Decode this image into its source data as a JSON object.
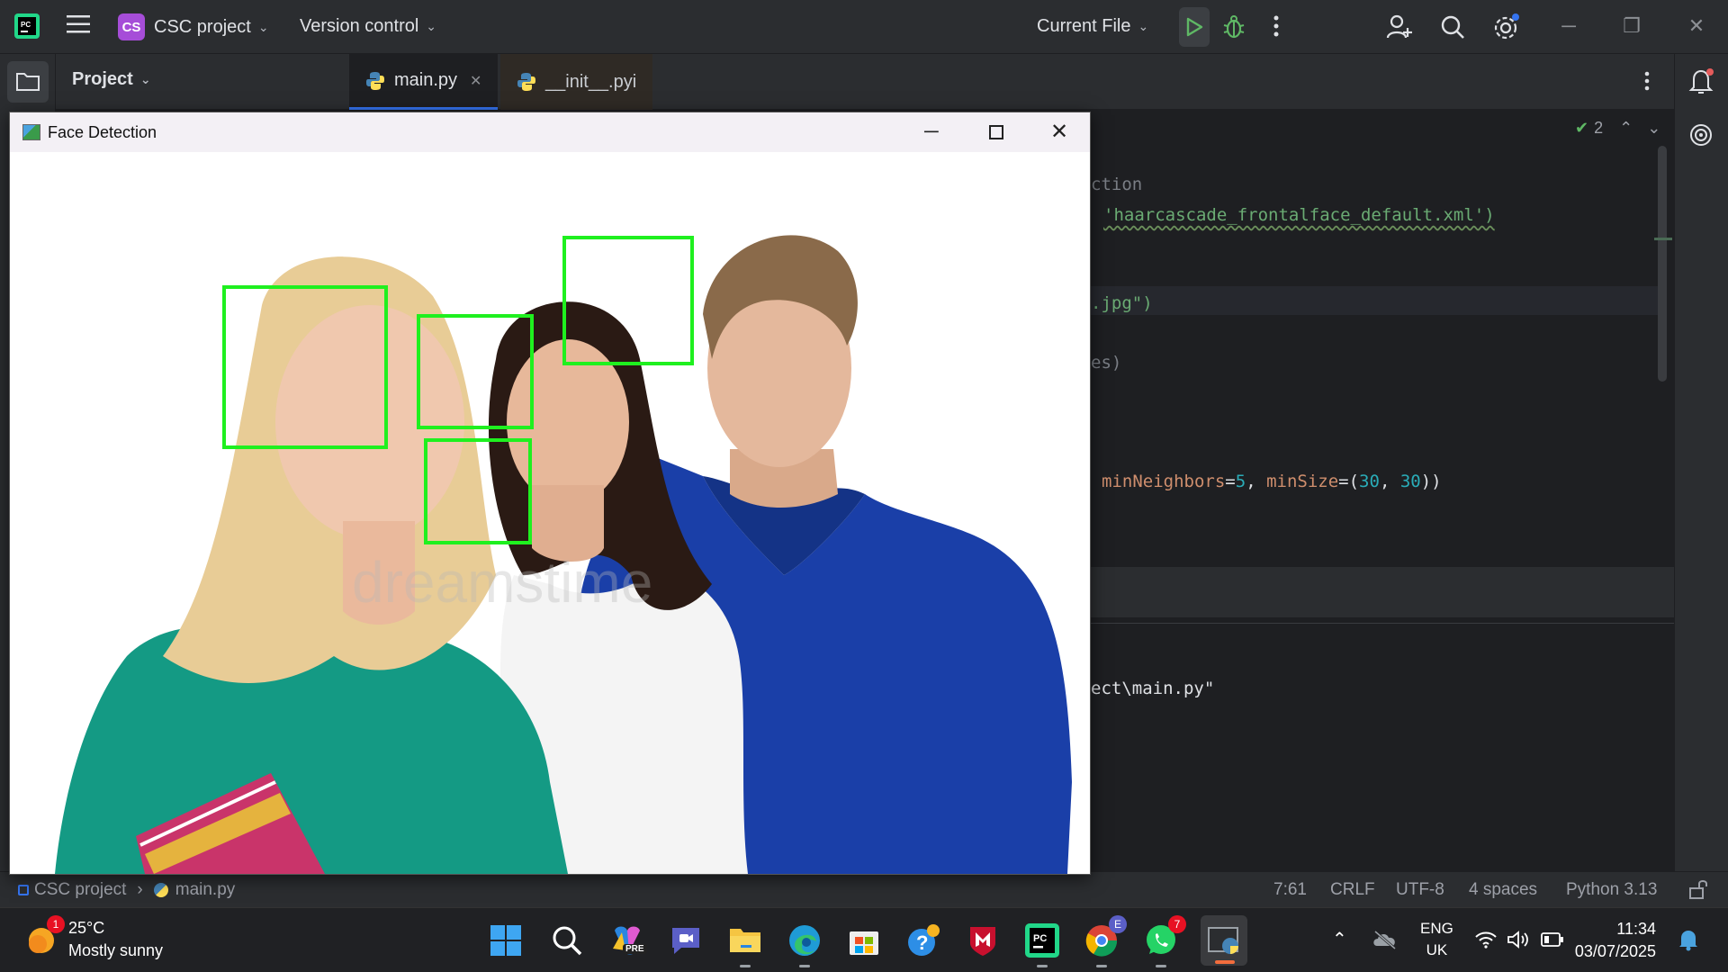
{
  "ide": {
    "project_badge": "CS",
    "project_name": "CSC project",
    "vcs_label": "Version control",
    "run_config": "Current File",
    "project_panel_label": "Project",
    "tabs": [
      {
        "label": "main.py",
        "active": true,
        "closable": true
      },
      {
        "label": "__init__.pyi",
        "active": false,
        "closable": false
      }
    ],
    "inspection_count": "2",
    "code_lines": [
      {
        "text": "ction",
        "class": "dim"
      },
      {
        "text": "'haarcascade_frontalface_default.xml')",
        "class": "str"
      },
      {
        "text": ".jpg\")",
        "class": "str"
      },
      {
        "text": "es)",
        "class": "dim"
      },
      {
        "text": "minNeighbors=5, minSize=(30, 30))",
        "class": "mixed"
      },
      {
        "text": "ect\\main.py\"",
        "class": "plain"
      }
    ]
  },
  "popup": {
    "title": "Face Detection",
    "watermark": "dreamstime",
    "faces_detected": 4
  },
  "statusbar": {
    "breadcrumb_project": "CSC project",
    "breadcrumb_file": "main.py",
    "cursor": "7:61",
    "line_sep": "CRLF",
    "encoding": "UTF-8",
    "indent": "4 spaces",
    "interpreter": "Python 3.13"
  },
  "taskbar": {
    "weather_temp": "25°C",
    "weather_desc": "Mostly sunny",
    "weather_badge": "1",
    "language_line1": "ENG",
    "language_line2": "UK",
    "time": "11:34",
    "date": "03/07/2025",
    "copilot_label": "PRE",
    "edge_profile_badge": "E",
    "whatsapp_badge": "7",
    "apps": [
      "start",
      "search",
      "copilot",
      "teams",
      "file-explorer",
      "edge",
      "store",
      "help",
      "mcafee",
      "pycharm",
      "chrome",
      "whatsapp",
      "python"
    ]
  },
  "colors": {
    "face_box": "#1ff01f",
    "accent": "#3574f0",
    "run_green": "#5fb865"
  }
}
